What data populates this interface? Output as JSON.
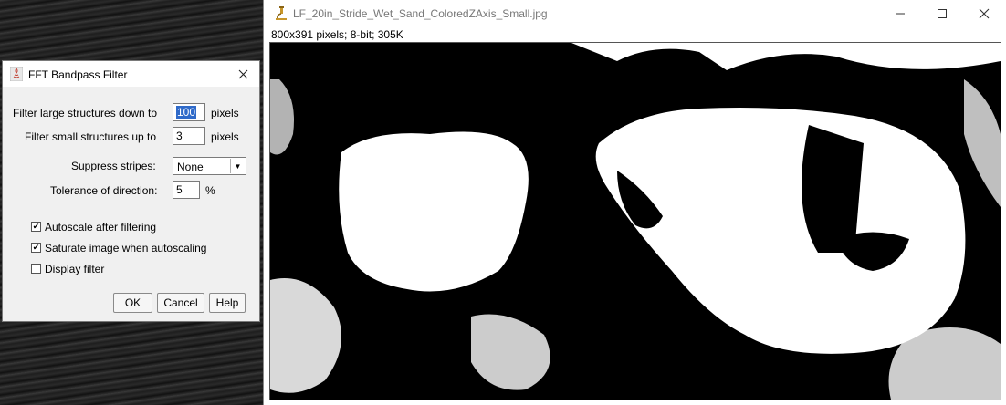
{
  "image_window": {
    "title": "LF_20in_Stride_Wet_Sand_ColoredZAxis_Small.jpg",
    "info": "800x391 pixels; 8-bit; 305K",
    "icons": [
      "microscope-icon",
      "minimize-icon",
      "maximize-icon",
      "close-icon"
    ]
  },
  "dialog": {
    "title": "FFT Bandpass Filter",
    "filter_large_label": "Filter large structures down to",
    "filter_large_value": "100",
    "filter_small_label": "Filter small structures up to",
    "filter_small_value": "3",
    "pixels_unit": "pixels",
    "suppress_label": "Suppress stripes:",
    "suppress_value": "None",
    "tolerance_label": "Tolerance of direction:",
    "tolerance_value": "5",
    "percent_unit": "%",
    "autoscale_label": "Autoscale after filtering",
    "autoscale_checked": true,
    "saturate_label": "Saturate image when autoscaling",
    "saturate_checked": true,
    "display_filter_label": "Display filter",
    "display_filter_checked": false,
    "ok_label": "OK",
    "cancel_label": "Cancel",
    "help_label": "Help"
  },
  "colors": {
    "selection": "#2f6ac9",
    "dialog_bg": "#f0f0f0",
    "image_fg": "#ffffff",
    "image_bg": "#000000"
  }
}
